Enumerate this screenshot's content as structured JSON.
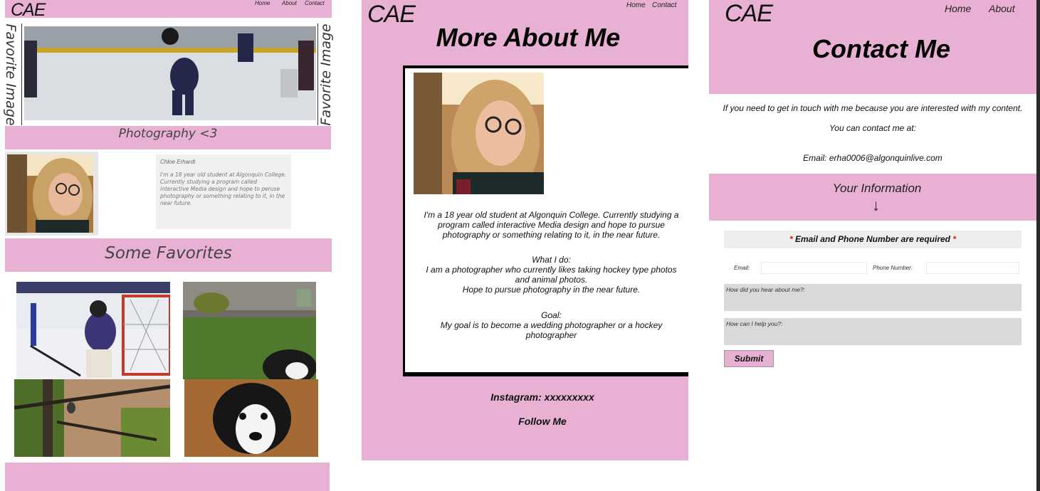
{
  "home_page": {
    "logo": "CAE",
    "nav": [
      "Home",
      "About",
      "Contact"
    ],
    "side_label_left": "Favorite Image",
    "side_label_right": "Favorite Image",
    "photography_label": "Photography <3",
    "bio": {
      "name": "Chloe Erhardt",
      "text": "I'm a 18 year old student at Algonquin College. Currently studying a program called interactive Media design and hope to peruse photography or something relating to it, in the near future."
    },
    "favorites_title": "Some Favorites"
  },
  "about_page": {
    "logo": "CAE",
    "nav": [
      "Home",
      "Contact"
    ],
    "title": "More About Me",
    "intro": "I'm a 18 year old student at Algonquin College. Currently studying a program called interactive Media design and hope to pursue photography or something relating to it, in the near future.",
    "what_heading": "What I do:",
    "what_text": "I am a photographer who currently likes taking hockey type photos and animal photos.",
    "what_text2": "Hope to pursue photography in the near future.",
    "goal_heading": "Goal:",
    "goal_text": "My goal is to become a wedding photographer or a hockey photographer",
    "instagram": "Instagram: xxxxxxxxx",
    "follow": "Follow Me"
  },
  "contact_page": {
    "logo": "CAE",
    "nav": [
      "Home",
      "About"
    ],
    "title": "Contact Me",
    "line1": "If you need to get in touch with me because you are interested with my content.",
    "line2": "You can contact me at:",
    "email_line": "Email: erha0006@algonquinlive.com",
    "info_title": "Your Information",
    "arrow": "↓",
    "required_star": "*",
    "required_text": " Email and Phone Number are required ",
    "email_label": "Email:",
    "phone_label": "Phone Number:",
    "hear_label": "How did you hear about me?:",
    "help_label": "How can I help you?:",
    "submit": "Submit"
  },
  "colors": {
    "accent_pink": "#e8b1d4",
    "required_red": "#e0141e"
  }
}
